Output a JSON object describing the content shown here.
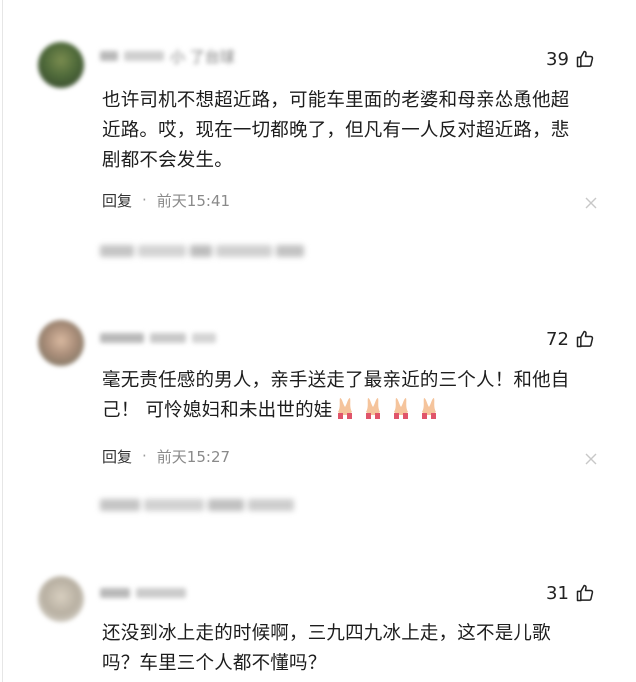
{
  "comments": [
    {
      "username": "小 了台球",
      "likes": "39",
      "text_lines": [
        "也许司机不想超近路，可能车里面的老婆和母亲怂恿他超",
        "近路。哎，现在一切都晚了，但凡有一人反对超近路，悲",
        "剧都不会发生。"
      ],
      "reply_label": "回复",
      "separator": "·",
      "time": "前天15:41"
    },
    {
      "username": "",
      "likes": "72",
      "text_lines": [
        "毫无责任感的男人，亲手送走了最亲近的三个人！和他自",
        "己！ 可怜媳妇和未出世的娃"
      ],
      "emoji": [
        "folded-hands",
        "folded-hands",
        "folded-hands",
        "folded-hands"
      ],
      "reply_label": "回复",
      "separator": "·",
      "time": "前天15:27"
    },
    {
      "username": "",
      "likes": "31",
      "text_lines": [
        "还没到冰上走的时候啊，三九四九冰上走，这不是儿歌",
        "吗？车里三个人都不懂吗？"
      ]
    }
  ],
  "colors": {
    "text": "#1d1d1d",
    "meta_time": "#8a8a8a",
    "blurred": "#c4c4c4"
  }
}
